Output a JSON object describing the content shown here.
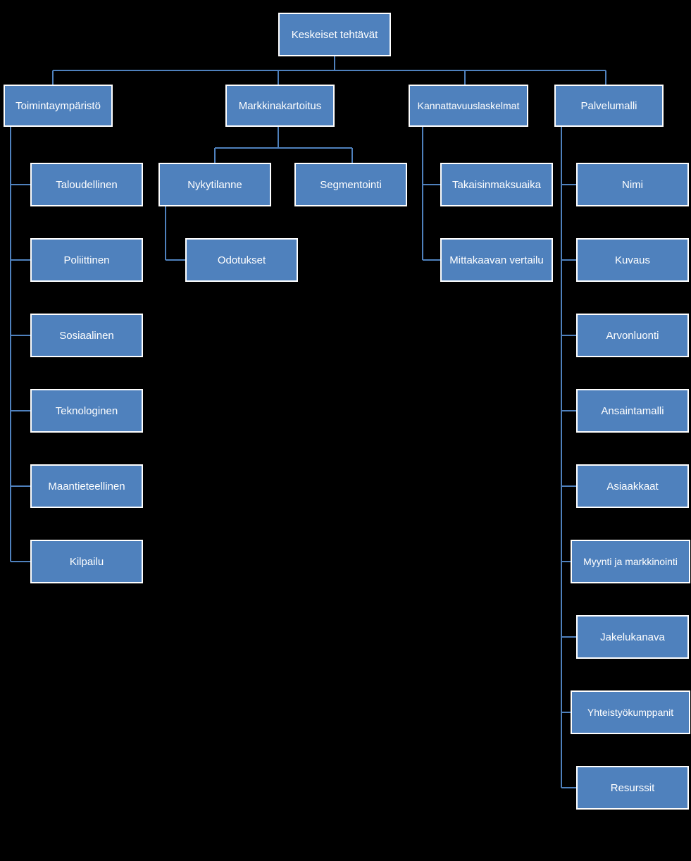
{
  "diagram": {
    "root": {
      "label": "Keskeiset tehtävät"
    },
    "branches": [
      {
        "label": "Toimintaympäristö",
        "children": [
          {
            "label": "Taloudellinen"
          },
          {
            "label": "Poliittinen"
          },
          {
            "label": "Sosiaalinen"
          },
          {
            "label": "Teknologinen"
          },
          {
            "label": "Maantieteellinen"
          },
          {
            "label": "Kilpailu"
          }
        ]
      },
      {
        "label": "Markkinakartoitus",
        "children": [
          {
            "label": "Nykytilanne",
            "children": [
              {
                "label": "Odotukset"
              }
            ]
          },
          {
            "label": "Segmentointi"
          }
        ]
      },
      {
        "label": "Kannattavuuslaskelmat",
        "children": [
          {
            "label": "Takaisinmaksuaika"
          },
          {
            "label": "Mittakaavan vertailu"
          }
        ]
      },
      {
        "label": "Palvelumalli",
        "children": [
          {
            "label": "Nimi"
          },
          {
            "label": "Kuvaus"
          },
          {
            "label": "Arvonluonti"
          },
          {
            "label": "Ansaintamalli"
          },
          {
            "label": "Asiaakkaat"
          },
          {
            "label": "Myynti ja markkinointi"
          },
          {
            "label": "Jakelukanava"
          },
          {
            "label": "Yhteistyökumppanit"
          },
          {
            "label": "Resurssit"
          }
        ]
      }
    ]
  },
  "colors": {
    "box_fill": "#4f81bd",
    "box_border": "#ffffff",
    "connector": "#4f81bd",
    "background": "#000000"
  }
}
